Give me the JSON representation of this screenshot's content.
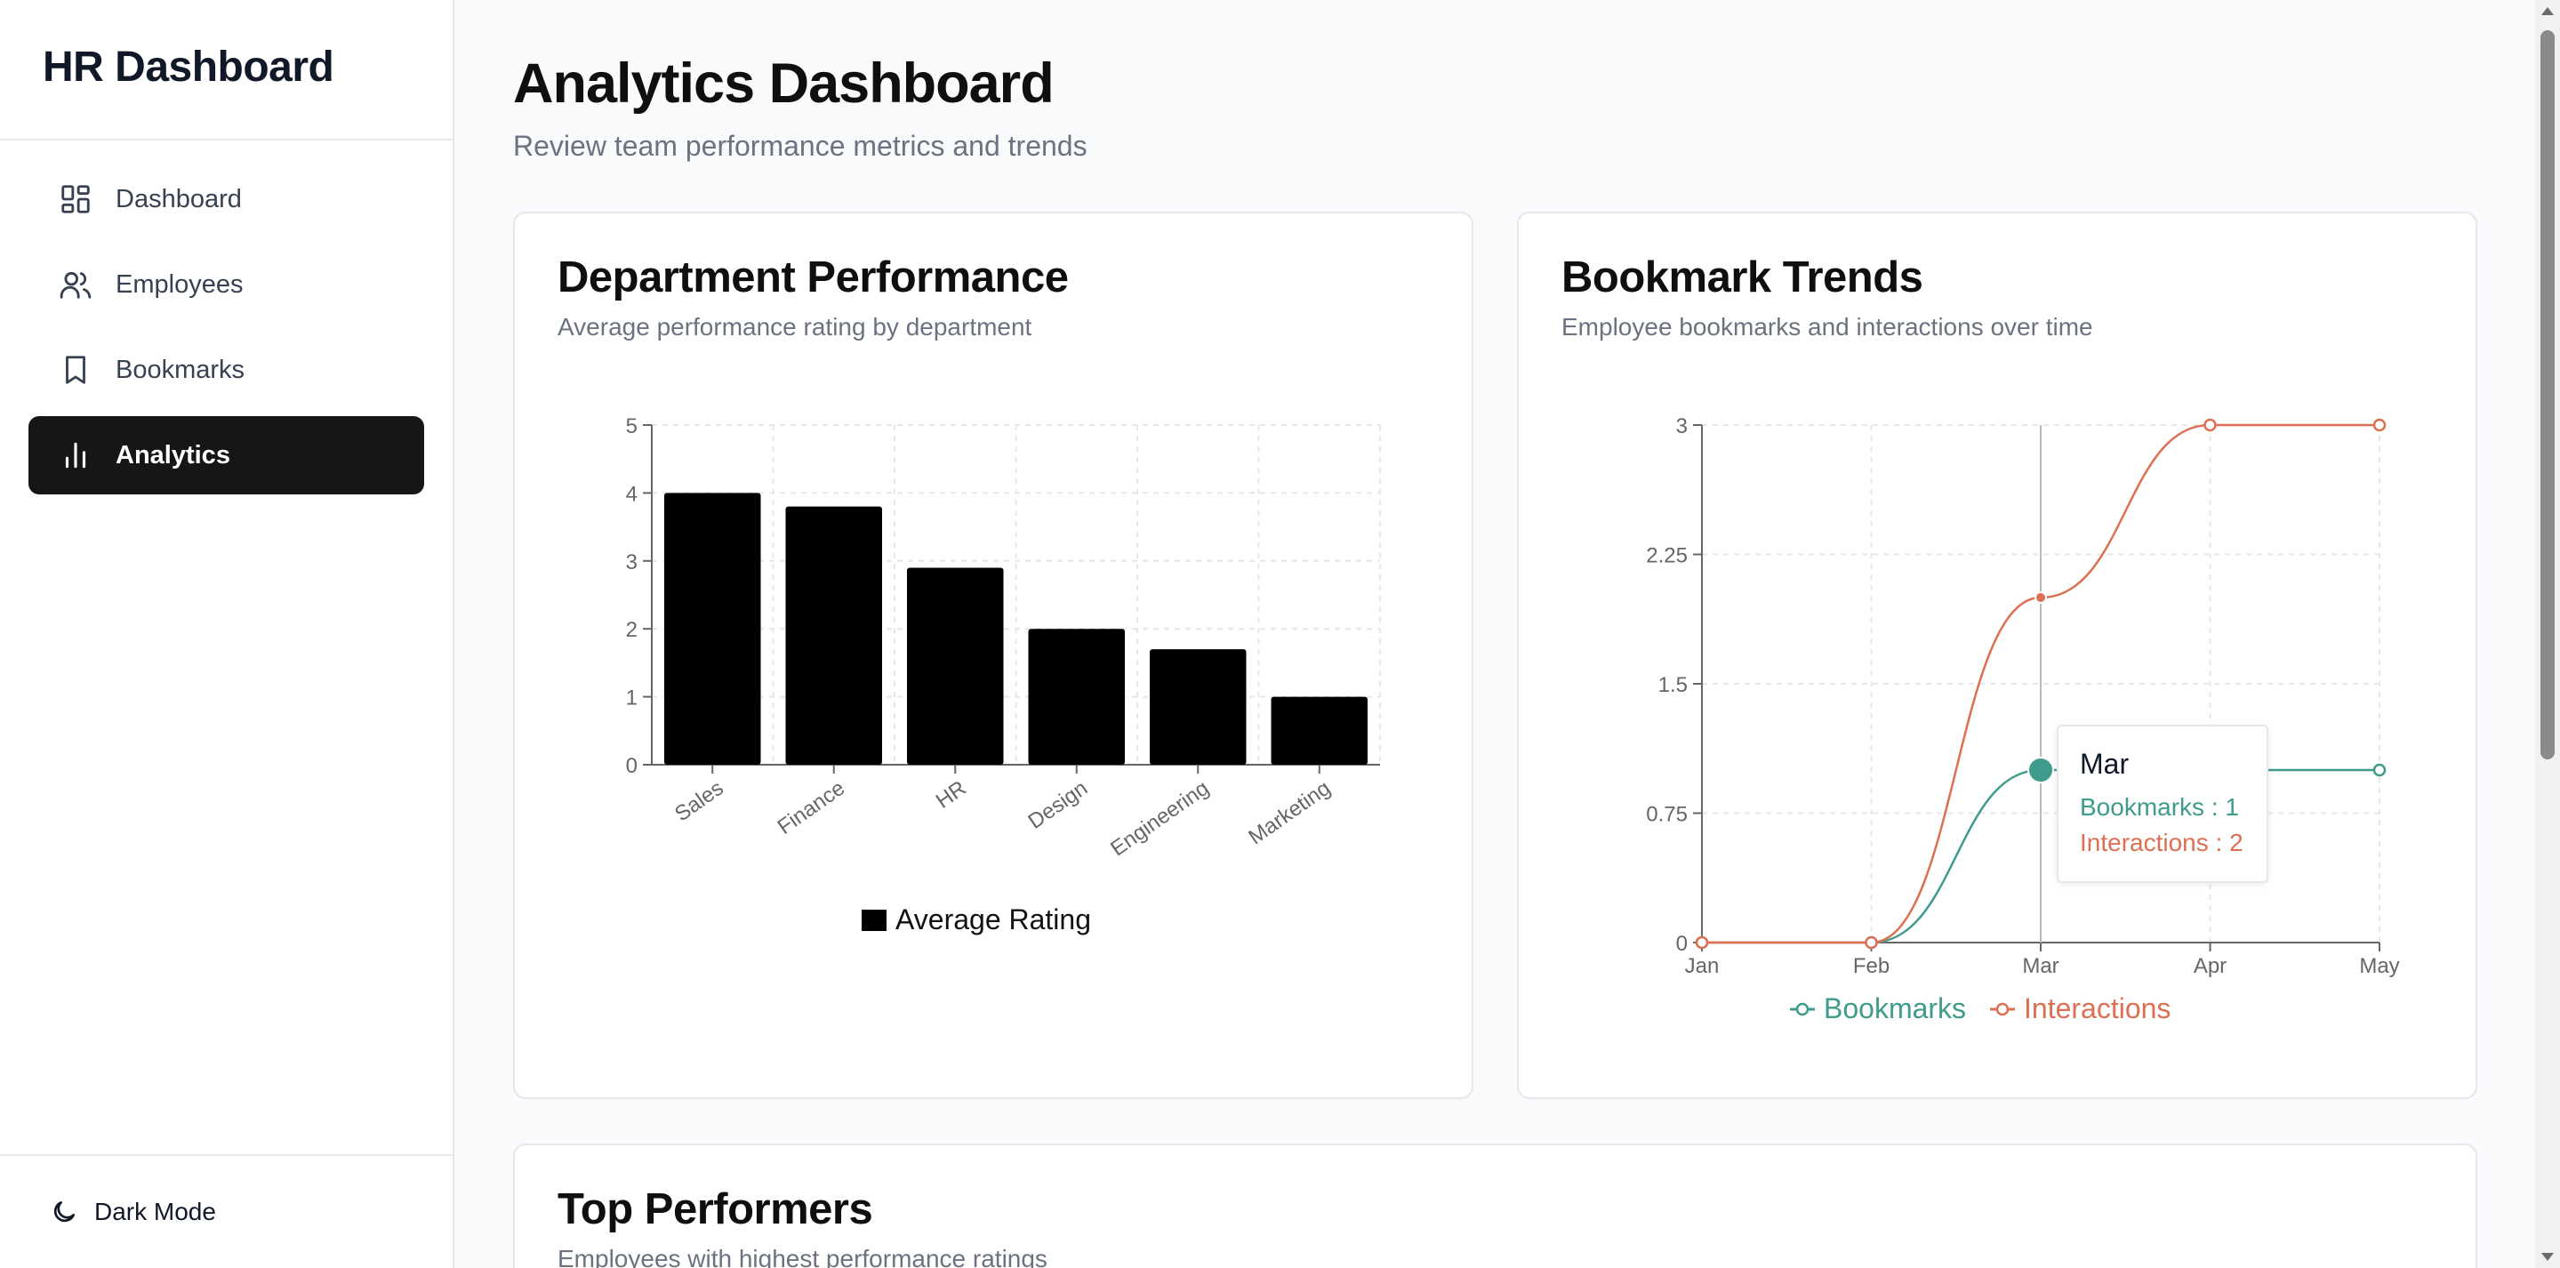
{
  "sidebar": {
    "brand": "HR Dashboard",
    "items": [
      {
        "label": "Dashboard",
        "icon": "layout-grid-icon"
      },
      {
        "label": "Employees",
        "icon": "users-icon"
      },
      {
        "label": "Bookmarks",
        "icon": "bookmark-icon"
      },
      {
        "label": "Analytics",
        "icon": "bar-chart-icon",
        "active": true
      }
    ],
    "footer": {
      "label": "Dark Mode",
      "icon": "moon-icon"
    }
  },
  "header": {
    "title": "Analytics Dashboard",
    "subtitle": "Review team performance metrics and trends"
  },
  "cards": {
    "department": {
      "title": "Department Performance",
      "subtitle": "Average performance rating by department"
    },
    "bookmarks": {
      "title": "Bookmark Trends",
      "subtitle": "Employee bookmarks and interactions over time",
      "tooltip": {
        "title": "Mar",
        "bookmarks_label": "Bookmarks : 1",
        "interactions_label": "Interactions : 2"
      }
    },
    "top": {
      "title": "Top Performers",
      "subtitle": "Employees with highest performance ratings"
    }
  },
  "colors": {
    "bar": "#000000",
    "bookmarks": "#3f9b8b",
    "interactions": "#dd6f52",
    "grid": "#e5e7eb"
  },
  "chart_data": [
    {
      "type": "bar",
      "categories": [
        "Sales",
        "Finance",
        "HR",
        "Design",
        "Engineering",
        "Marketing"
      ],
      "series": [
        {
          "name": "Average Rating",
          "values": [
            4.0,
            3.8,
            2.9,
            2.0,
            1.7,
            1.0
          ]
        }
      ],
      "ylim": [
        0,
        5
      ],
      "yticks": [
        "0",
        "1",
        "2",
        "3",
        "4",
        "5"
      ],
      "grid": true,
      "legend": "bottom"
    },
    {
      "type": "line",
      "x": [
        "Jan",
        "Feb",
        "Mar",
        "Apr",
        "May"
      ],
      "series": [
        {
          "name": "Bookmarks",
          "values": [
            0,
            0,
            1,
            1,
            1
          ]
        },
        {
          "name": "Interactions",
          "values": [
            0,
            0,
            2,
            3,
            3
          ]
        }
      ],
      "ylim": [
        0,
        3
      ],
      "yticks": [
        "0",
        "0.75",
        "1.5",
        "2.25",
        "3"
      ],
      "grid": true,
      "legend": "bottom"
    }
  ]
}
